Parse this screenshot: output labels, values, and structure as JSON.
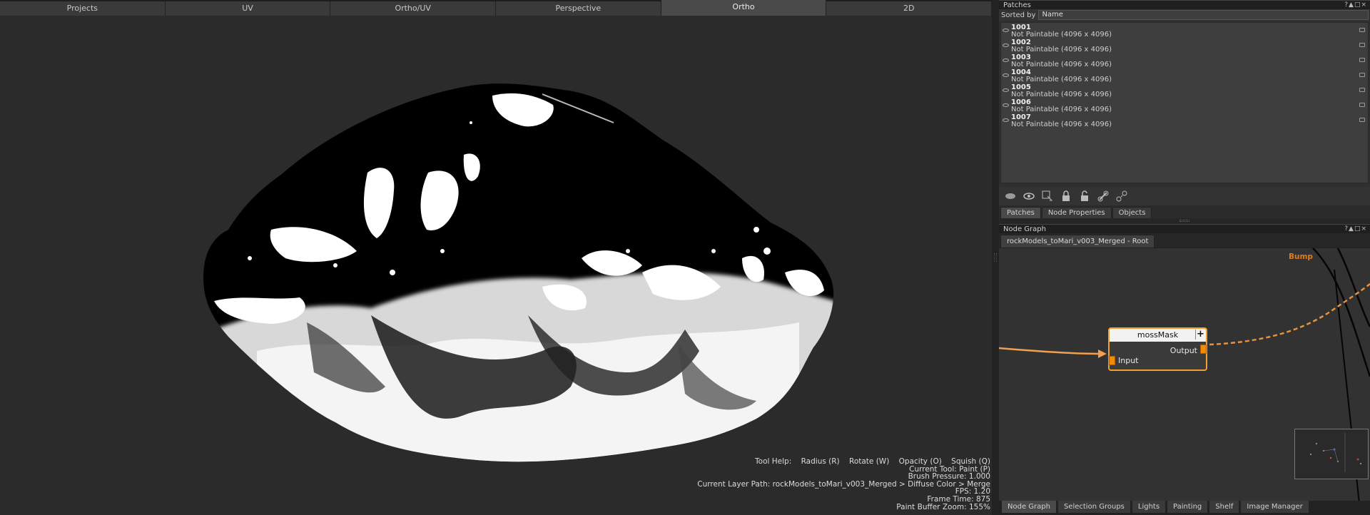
{
  "viewport_tabs": [
    {
      "label": "Projects",
      "active": false
    },
    {
      "label": "UV",
      "active": false
    },
    {
      "label": "Ortho/UV",
      "active": false
    },
    {
      "label": "Perspective",
      "active": false
    },
    {
      "label": "Ortho",
      "active": true
    },
    {
      "label": "2D",
      "active": false
    }
  ],
  "hud": {
    "tool_help_label": "Tool Help:",
    "tool_help_items": [
      "Radius (R)",
      "Rotate (W)",
      "Opacity (O)",
      "Squish (Q)"
    ],
    "current_tool": "Current Tool: Paint (P)",
    "brush_pressure": "Brush Pressure: 1.000",
    "layer_path": "Current Layer Path: rockModels_toMari_v003_Merged > Diffuse Color > Merge",
    "fps": "FPS: 1.20",
    "frame_time": "Frame Time: 875",
    "paint_buffer_zoom": "Paint Buffer Zoom: 155%"
  },
  "patches_palette": {
    "title": "Patches",
    "sort_label": "Sorted by",
    "sort_value": "Name",
    "patches": [
      {
        "id": "1001",
        "info": "Not Paintable (4096 x 4096)"
      },
      {
        "id": "1002",
        "info": "Not Paintable (4096 x 4096)"
      },
      {
        "id": "1003",
        "info": "Not Paintable (4096 x 4096)"
      },
      {
        "id": "1004",
        "info": "Not Paintable (4096 x 4096)"
      },
      {
        "id": "1005",
        "info": "Not Paintable (4096 x 4096)"
      },
      {
        "id": "1006",
        "info": "Not Paintable (4096 x 4096)"
      },
      {
        "id": "1007",
        "info": "Not Paintable (4096 x 4096)"
      }
    ],
    "toolbar_icons": [
      "show-icon",
      "eye-icon",
      "select-icon",
      "lock-icon",
      "unlock-icon",
      "link-icon",
      "unlink-icon"
    ],
    "tabs": [
      {
        "label": "Patches",
        "active": true
      },
      {
        "label": "Node Properties",
        "active": false
      },
      {
        "label": "Objects",
        "active": false
      }
    ]
  },
  "node_graph": {
    "title": "Node Graph",
    "breadcrumb_tab": "rockModels_toMari_v003_Merged - Root",
    "bump_label": "Bump",
    "node": {
      "name": "mossMask",
      "plus": "+",
      "output_label": "Output",
      "input_label": "Input"
    },
    "accent_color": "#f0a030",
    "bottom_tabs": [
      {
        "label": "Node Graph",
        "active": true
      },
      {
        "label": "Selection Groups",
        "active": false
      },
      {
        "label": "Lights",
        "active": false
      },
      {
        "label": "Painting",
        "active": false
      },
      {
        "label": "Shelf",
        "active": false
      },
      {
        "label": "Image Manager",
        "active": false
      }
    ]
  },
  "palette_controls": "?▲□×"
}
